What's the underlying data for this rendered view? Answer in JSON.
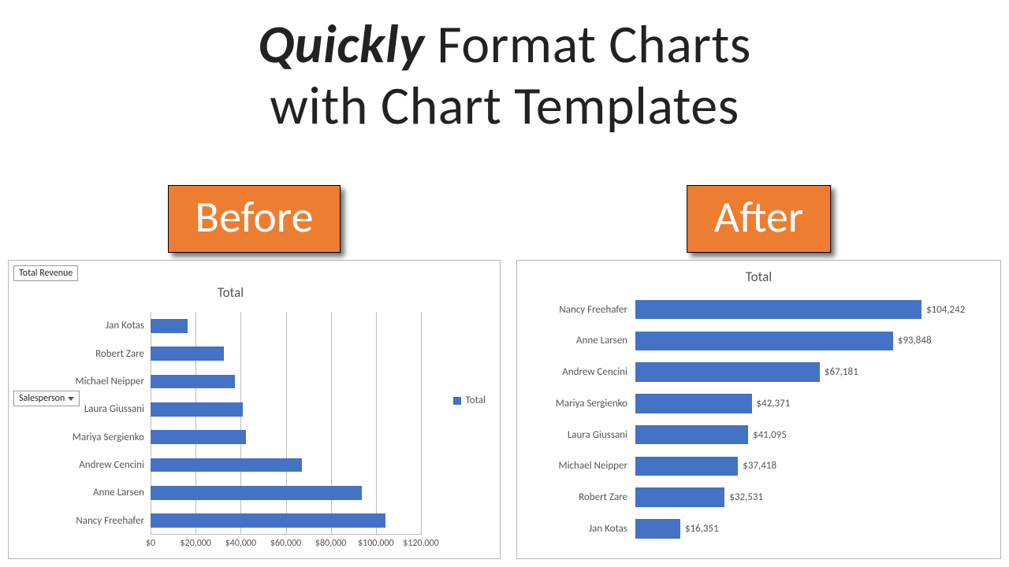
{
  "headline": {
    "emph": "Quickly",
    "rest1": " Format Charts",
    "rest2": "with Chart Templates"
  },
  "badges": {
    "before": "Before",
    "after": "After"
  },
  "before": {
    "field_total": "Total Revenue",
    "field_cat": "Salesperson",
    "title": "Total",
    "legend": "Total",
    "xmax": 120000,
    "ticks": [
      "$0",
      "$20,000",
      "$40,000",
      "$60,000",
      "$80,000",
      "$100,000",
      "$120,000"
    ],
    "categories": [
      "Jan Kotas",
      "Robert Zare",
      "Michael Neipper",
      "Laura Giussani",
      "Mariya Sergienko",
      "Andrew Cencini",
      "Anne Larsen",
      "Nancy Freehafer"
    ],
    "values": [
      16351,
      32531,
      37418,
      41095,
      42371,
      67181,
      93848,
      104242
    ]
  },
  "after": {
    "title": "Total",
    "categories": [
      "Nancy Freehafer",
      "Anne Larsen",
      "Andrew Cencini",
      "Mariya Sergienko",
      "Laura Giussani",
      "Michael Neipper",
      "Robert Zare",
      "Jan Kotas"
    ],
    "values": [
      104242,
      93848,
      67181,
      42371,
      41095,
      37418,
      32531,
      16351
    ],
    "labels": [
      "$104,242",
      "$93,848",
      "$67,181",
      "$42,371",
      "$41,095",
      "$37,418",
      "$32,531",
      "$16,351"
    ],
    "max": 110000
  },
  "chart_data": [
    {
      "type": "bar",
      "orientation": "horizontal",
      "title": "Total",
      "categories": [
        "Jan Kotas",
        "Robert Zare",
        "Michael Neipper",
        "Laura Giussani",
        "Mariya Sergienko",
        "Andrew Cencini",
        "Anne Larsen",
        "Nancy Freehafer"
      ],
      "series": [
        {
          "name": "Total",
          "values": [
            16351,
            32531,
            37418,
            41095,
            42371,
            67181,
            93848,
            104242
          ]
        }
      ],
      "xlabel": "",
      "ylabel": "",
      "xlim": [
        0,
        120000
      ],
      "x_ticks": [
        0,
        20000,
        40000,
        60000,
        80000,
        100000,
        120000
      ],
      "legend": "right",
      "note": "Before formatting; PivotChart field buttons visible (Total Revenue, Salesperson)"
    },
    {
      "type": "bar",
      "orientation": "horizontal",
      "title": "Total",
      "categories": [
        "Nancy Freehafer",
        "Anne Larsen",
        "Andrew Cencini",
        "Mariya Sergienko",
        "Laura Giussani",
        "Michael Neipper",
        "Robert Zare",
        "Jan Kotas"
      ],
      "series": [
        {
          "name": "Total",
          "values": [
            104242,
            93848,
            67181,
            42371,
            41095,
            37418,
            32531,
            16351
          ]
        }
      ],
      "data_labels": true,
      "xlabel": "",
      "ylabel": "",
      "note": "After formatting; sorted descending with data labels, no axis/gridlines"
    }
  ]
}
